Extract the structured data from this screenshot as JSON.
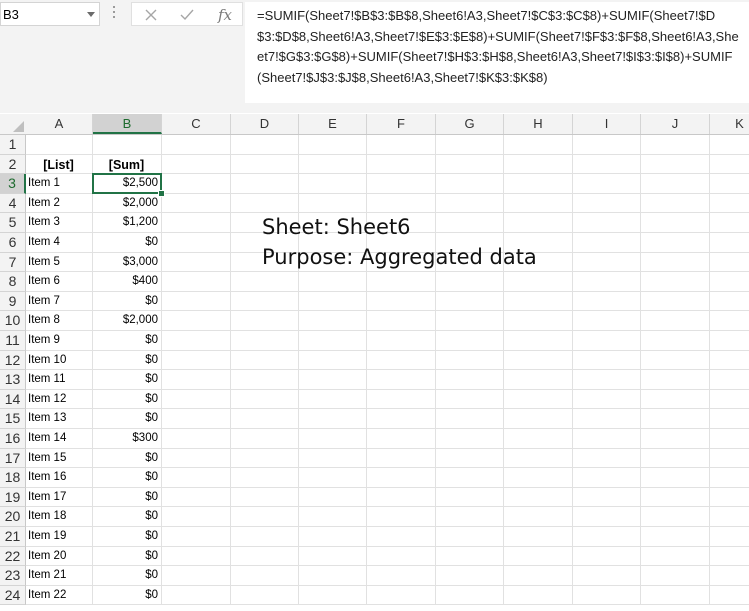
{
  "name_box": {
    "value": "B3"
  },
  "formula_bar": {
    "cancel_symbol": "✕",
    "enter_symbol": "✓",
    "fx_label": "fx",
    "formula": "=SUMIF(Sheet7!$B$3:$B$8,Sheet6!A3,Sheet7!$C$3:$C$8)+SUMIF(Sheet7!$D$3:$D$8,Sheet6!A3,Sheet7!$E$3:$E$8)+SUMIF(Sheet7!$F$3:$F$8,Sheet6!A3,Sheet7!$G$3:$G$8)+SUMIF(Sheet7!$H$3:$H$8,Sheet6!A3,Sheet7!$I$3:$I$8)+SUMIF(Sheet7!$J$3:$J$8,Sheet6!A3,Sheet7!$K$3:$K$8)"
  },
  "columns": [
    "A",
    "B",
    "C",
    "D",
    "E",
    "F",
    "G",
    "H",
    "I",
    "J",
    "K"
  ],
  "selected_column": "B",
  "selected_row": "3",
  "rows": [
    "1",
    "2",
    "3",
    "4",
    "5",
    "6",
    "7",
    "8",
    "9",
    "10",
    "11",
    "12",
    "13",
    "14",
    "15",
    "16",
    "17",
    "18",
    "19",
    "20",
    "21",
    "22",
    "23",
    "24"
  ],
  "table": {
    "headers": [
      "[List]",
      "[Sum]"
    ],
    "items": [
      [
        "Item 1",
        "$2,500"
      ],
      [
        "Item 2",
        "$2,000"
      ],
      [
        "Item 3",
        "$1,200"
      ],
      [
        "Item 4",
        "$0"
      ],
      [
        "Item 5",
        "$3,000"
      ],
      [
        "Item 6",
        "$400"
      ],
      [
        "Item 7",
        "$0"
      ],
      [
        "Item 8",
        "$2,000"
      ],
      [
        "Item 9",
        "$0"
      ],
      [
        "Item 10",
        "$0"
      ],
      [
        "Item 11",
        "$0"
      ],
      [
        "Item 12",
        "$0"
      ],
      [
        "Item 13",
        "$0"
      ],
      [
        "Item 14",
        "$300"
      ],
      [
        "Item 15",
        "$0"
      ],
      [
        "Item 16",
        "$0"
      ],
      [
        "Item 17",
        "$0"
      ],
      [
        "Item 18",
        "$0"
      ],
      [
        "Item 19",
        "$0"
      ],
      [
        "Item 20",
        "$0"
      ],
      [
        "Item 21",
        "$0"
      ],
      [
        "Item 22",
        "$0"
      ]
    ]
  },
  "note": {
    "line1": "Sheet: Sheet6",
    "line2": "Purpose: Aggregated data"
  },
  "colors": {
    "accent": "#217346",
    "header_bg": "#f3f3f3",
    "selected_header_bg": "#d2d2d2"
  },
  "icons": {
    "cancel": "close-icon",
    "enter": "check-icon",
    "function": "fx-icon",
    "name_box_dropdown": "chevron-down-icon"
  }
}
